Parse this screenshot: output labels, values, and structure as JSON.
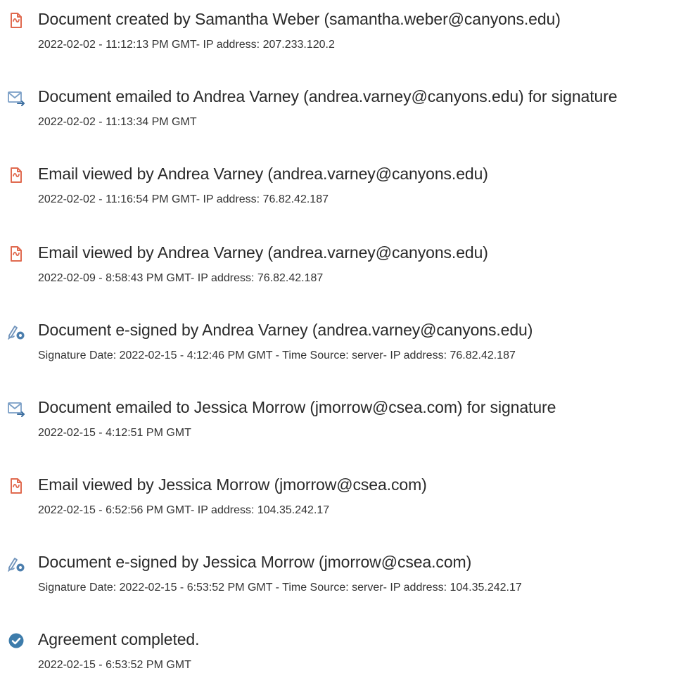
{
  "colors": {
    "created_icon": "#e06a4f",
    "email_icon": "#7a9fc6",
    "sign_icon": "#5a84b0",
    "complete_icon": "#3d7cab",
    "text": "#2a2a2a"
  },
  "events": [
    {
      "icon": "document-created-icon",
      "title": "Document created by Samantha Weber (samantha.weber@canyons.edu)",
      "detail": "2022-02-02 - 11:12:13 PM GMT- IP address: 207.233.120.2"
    },
    {
      "icon": "email-sent-icon",
      "title": "Document emailed to Andrea Varney (andrea.varney@canyons.edu) for signature",
      "detail": "2022-02-02 - 11:13:34 PM GMT"
    },
    {
      "icon": "email-viewed-icon",
      "title": "Email viewed by Andrea Varney (andrea.varney@canyons.edu)",
      "detail": "2022-02-02 - 11:16:54 PM GMT- IP address: 76.82.42.187"
    },
    {
      "icon": "email-viewed-icon",
      "title": "Email viewed by Andrea Varney (andrea.varney@canyons.edu)",
      "detail": "2022-02-09 - 8:58:43 PM GMT- IP address: 76.82.42.187"
    },
    {
      "icon": "e-sign-icon",
      "title": "Document e-signed by Andrea Varney (andrea.varney@canyons.edu)",
      "detail": "Signature Date: 2022-02-15 - 4:12:46 PM GMT - Time Source: server- IP address: 76.82.42.187"
    },
    {
      "icon": "email-sent-icon",
      "title": "Document emailed to Jessica Morrow (jmorrow@csea.com) for signature",
      "detail": "2022-02-15 - 4:12:51 PM GMT"
    },
    {
      "icon": "email-viewed-icon",
      "title": "Email viewed by Jessica Morrow (jmorrow@csea.com)",
      "detail": "2022-02-15 - 6:52:56 PM GMT- IP address: 104.35.242.17"
    },
    {
      "icon": "e-sign-icon",
      "title": "Document e-signed by Jessica Morrow (jmorrow@csea.com)",
      "detail": "Signature Date: 2022-02-15 - 6:53:52 PM GMT - Time Source: server- IP address: 104.35.242.17"
    },
    {
      "icon": "agreement-completed-icon",
      "title": "Agreement completed.",
      "detail": "2022-02-15 - 6:53:52 PM GMT"
    }
  ]
}
